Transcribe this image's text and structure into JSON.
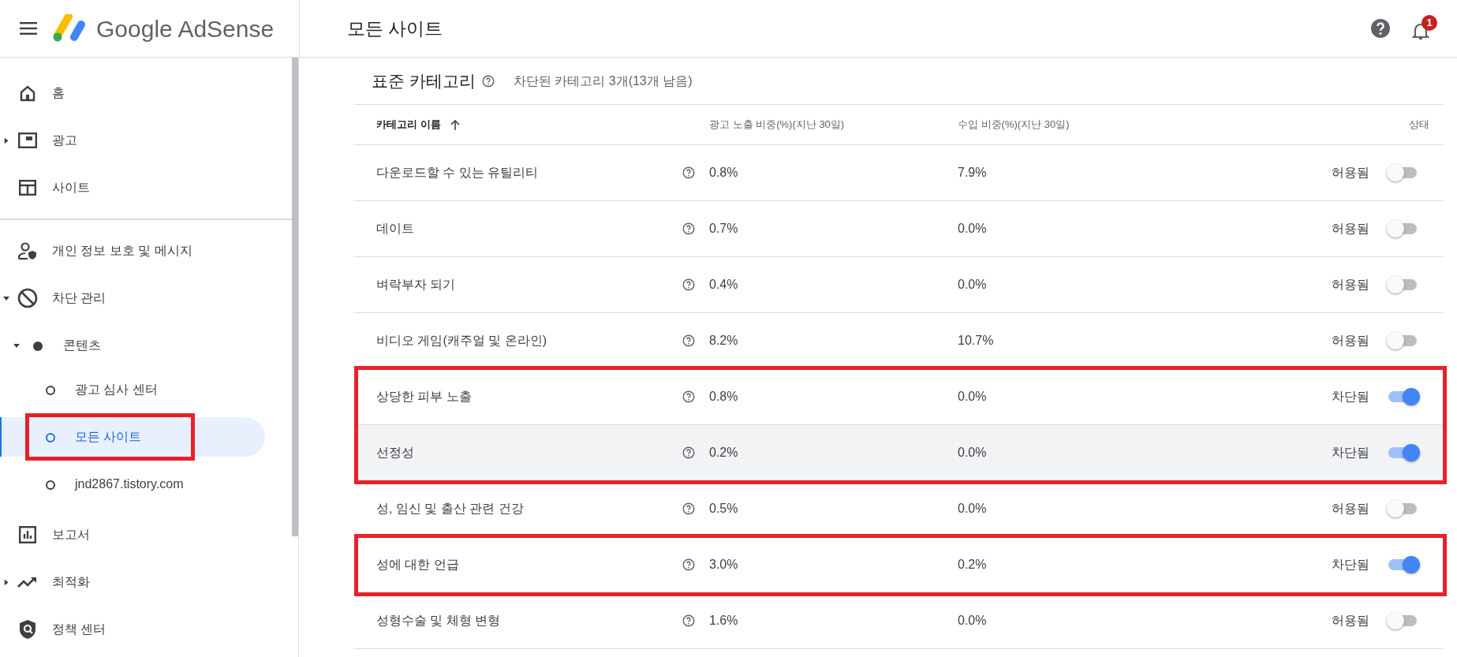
{
  "header": {
    "product": "Google AdSense",
    "page_title": "모든 사이트",
    "notification_count": "1"
  },
  "sidebar": {
    "sections": [
      [
        {
          "label": "홈"
        },
        {
          "label": "광고",
          "expanded": false
        },
        {
          "label": "사이트"
        }
      ],
      [
        {
          "label": "개인 정보 보호 및 메시지"
        },
        {
          "label": "차단 관리",
          "expanded": true,
          "children": [
            {
              "label": "콘텐츠",
              "expanded": true,
              "children": [
                {
                  "label": "광고 심사 센터",
                  "selected": false,
                  "annotated": false
                },
                {
                  "label": "모든 사이트",
                  "selected": true,
                  "annotated": true
                },
                {
                  "label": "jnd2867.tistory.com",
                  "selected": false,
                  "annotated": false
                }
              ]
            }
          ]
        },
        {
          "label": "보고서"
        },
        {
          "label": "최적화",
          "expanded": false
        },
        {
          "label": "정책 센터"
        }
      ]
    ]
  },
  "section": {
    "title": "표준 카테고리",
    "summary": "차단된 카테고리 3개(13개 남음)"
  },
  "table": {
    "columns": [
      {
        "label": "카테고리 이름",
        "sorted": true
      },
      {
        "label": "광고 노출 비중(%)(지난 30일)",
        "sorted": false
      },
      {
        "label": "수입 비중(%)(지난 30일)",
        "sorted": false
      },
      {
        "label": "상태",
        "sorted": false
      }
    ],
    "rows": [
      {
        "name": "다운로드할 수 있는 유틸리티",
        "impressions": "0.8%",
        "revenue": "7.9%",
        "status": "허용됨",
        "blocked": false,
        "hovered": false,
        "annotated": false
      },
      {
        "name": "데이트",
        "impressions": "0.7%",
        "revenue": "0.0%",
        "status": "허용됨",
        "blocked": false,
        "hovered": false,
        "annotated": false
      },
      {
        "name": "벼락부자 되기",
        "impressions": "0.4%",
        "revenue": "0.0%",
        "status": "허용됨",
        "blocked": false,
        "hovered": false,
        "annotated": false
      },
      {
        "name": "비디오 게임(캐주얼 및 온라인)",
        "impressions": "8.2%",
        "revenue": "10.7%",
        "status": "허용됨",
        "blocked": false,
        "hovered": false,
        "annotated": false
      },
      {
        "name": "상당한 피부 노출",
        "impressions": "0.8%",
        "revenue": "0.0%",
        "status": "차단됨",
        "blocked": true,
        "hovered": false,
        "annotated": true
      },
      {
        "name": "선정성",
        "impressions": "0.2%",
        "revenue": "0.0%",
        "status": "차단됨",
        "blocked": true,
        "hovered": true,
        "annotated": true
      },
      {
        "name": "성, 임신 및 출산 관련 건강",
        "impressions": "0.5%",
        "revenue": "0.0%",
        "status": "허용됨",
        "blocked": false,
        "hovered": false,
        "annotated": false
      },
      {
        "name": "성에 대한 언급",
        "impressions": "3.0%",
        "revenue": "0.2%",
        "status": "차단됨",
        "blocked": true,
        "hovered": false,
        "annotated": true
      },
      {
        "name": "성형수술 및 체형 변형",
        "impressions": "1.6%",
        "revenue": "0.0%",
        "status": "허용됨",
        "blocked": false,
        "hovered": false,
        "annotated": false
      }
    ]
  }
}
